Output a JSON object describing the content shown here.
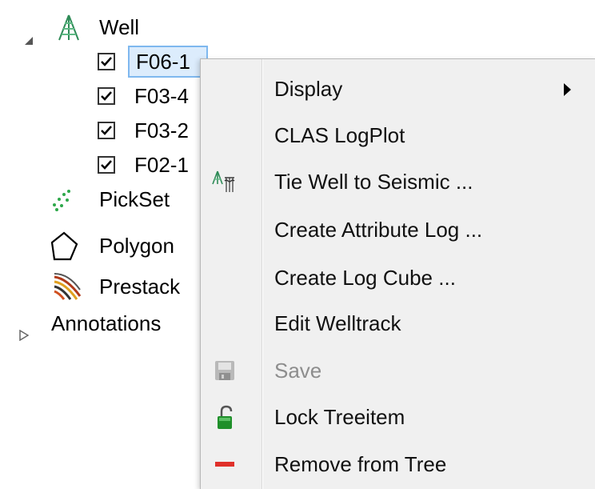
{
  "tree": {
    "well": {
      "label": "Well",
      "expanded": true
    },
    "wells": [
      {
        "label": "F06-1",
        "checked": true,
        "selected": true
      },
      {
        "label": "F03-4",
        "checked": true
      },
      {
        "label": "F03-2",
        "checked": true
      },
      {
        "label": "F02-1",
        "checked": true
      }
    ],
    "pickset": {
      "label": "PickSet"
    },
    "polygon": {
      "label": "Polygon"
    },
    "prestack": {
      "label": "Prestack"
    },
    "annotations": {
      "label": "Annotations",
      "expanded": false
    }
  },
  "context_menu": {
    "items": [
      {
        "label": "Display",
        "icon": "",
        "submenu": true,
        "enabled": true
      },
      {
        "label": "CLAS LogPlot",
        "icon": "",
        "enabled": true
      },
      {
        "label": "Tie Well to Seismic ...",
        "icon": "tie-well-icon",
        "enabled": true
      },
      {
        "label": "Create Attribute Log ...",
        "icon": "",
        "enabled": true
      },
      {
        "label": "Create Log Cube ...",
        "icon": "",
        "enabled": true
      },
      {
        "label": "Edit Welltrack",
        "icon": "",
        "enabled": true
      },
      {
        "label": "Save",
        "icon": "save-icon",
        "enabled": false
      },
      {
        "label": "Lock Treeitem",
        "icon": "unlock-icon",
        "enabled": true
      },
      {
        "label": "Remove from Tree",
        "icon": "remove-icon",
        "enabled": true
      }
    ]
  },
  "colors": {
    "selection_fill": "#dcecfc",
    "selection_border": "#7fb8ef",
    "menu_background": "#f0f0f0",
    "disabled_text": "#8d8d8d",
    "remove_icon": "#e0302a",
    "lock_icon": "#1f8f2a"
  }
}
